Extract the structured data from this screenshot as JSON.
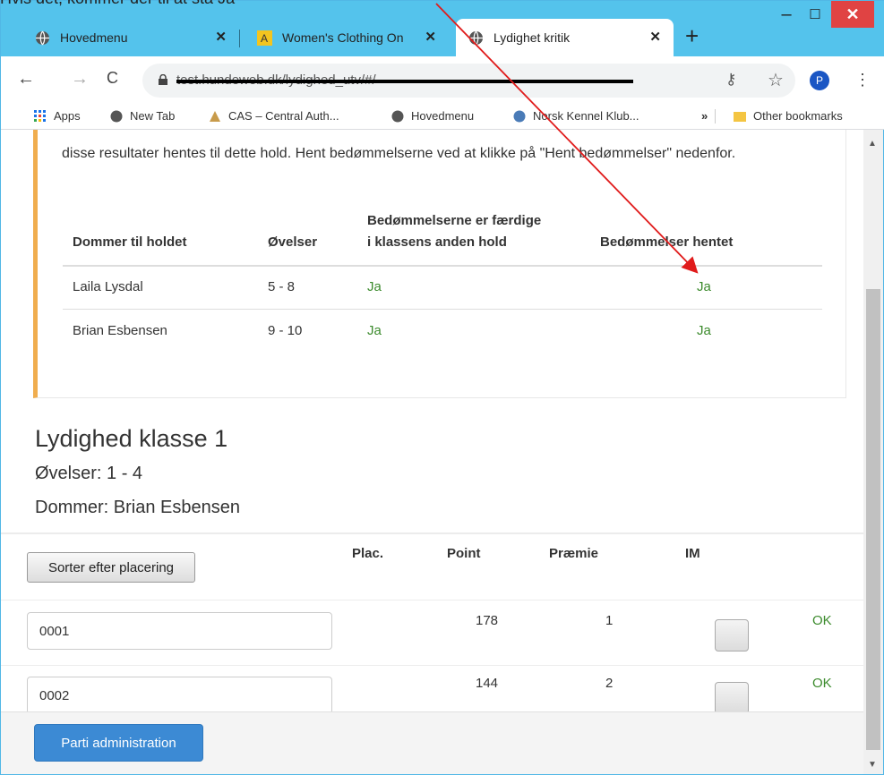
{
  "annotation": {
    "text": "Hvis det, kommer der til at stå Ja"
  },
  "window": {
    "tabs": [
      {
        "label": "Hovedmenu",
        "close": "✕",
        "active": false
      },
      {
        "label": "Women's Clothing On",
        "close": "✕",
        "active": false
      },
      {
        "label": "Lydighet kritik",
        "close": "✕",
        "active": true
      }
    ],
    "new_tab": "+",
    "minimize": "–",
    "maximize": "☐",
    "close": "✕"
  },
  "toolbar": {
    "back": "←",
    "forward": "→",
    "reload": "C",
    "url": "test.hundeweb.dk/lydighed_utv/#/",
    "key_icon": "⚷",
    "star": "☆",
    "profile": "P",
    "menu": "⋮"
  },
  "bookmarks": {
    "apps": "Apps",
    "items": [
      "New Tab",
      "CAS – Central Auth...",
      "Hovedmenu",
      "Norsk Kennel Klub..."
    ],
    "more": "»",
    "other": "Other bookmarks"
  },
  "alert": {
    "text": "disse resultater hentes til dette hold. Hent bedømmelserne ved at klikke på \"Hent bedømmelser\" nedenfor.",
    "headers": {
      "judge": "Dommer til holdet",
      "exercises": "Øvelser",
      "done_line1": "Bedømmelserne er færdige",
      "done_line2": "i klassens anden hold",
      "fetched": "Bedømmelser hentet"
    },
    "rows": [
      {
        "judge": "Laila Lysdal",
        "exercises": "5 - 8",
        "done": "Ja",
        "fetched": "Ja"
      },
      {
        "judge": "Brian Esbensen",
        "exercises": "9 - 10",
        "done": "Ja",
        "fetched": "Ja"
      }
    ]
  },
  "section": {
    "title": "Lydighed klasse 1",
    "exercises": "Øvelser: 1 - 4",
    "judge": "Dommer: Brian Esbensen"
  },
  "results": {
    "sort_label": "Sorter efter placering",
    "columns": {
      "plac": "Plac.",
      "point": "Point",
      "praemie": "Præmie",
      "im": "IM"
    },
    "rows": [
      {
        "id": "0001",
        "point": "178",
        "praemie": "1",
        "status": "OK"
      },
      {
        "id": "0002",
        "point": "144",
        "praemie": "2",
        "status": "OK"
      }
    ]
  },
  "footer": {
    "parti_label": "Parti administration"
  },
  "colors": {
    "accent": "#54c3ec",
    "ok": "#3c8b2d",
    "warning": "#f0ad4e",
    "primary": "#3c8ad4",
    "arrow": "#e01b1b"
  }
}
